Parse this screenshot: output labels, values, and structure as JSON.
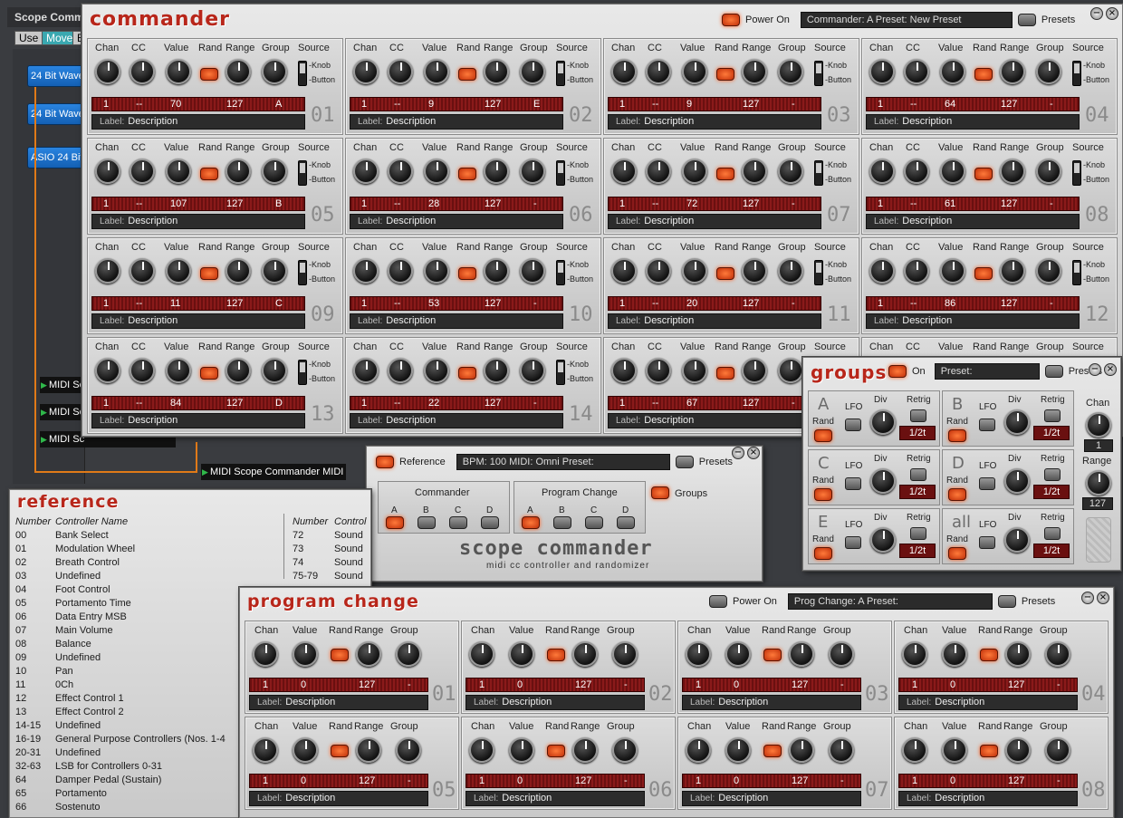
{
  "background": {
    "title": "Scope Comm",
    "tabs": [
      "Use",
      "Move",
      "E"
    ],
    "blocks": [
      "24 Bit Wave",
      "24 Bit Wave",
      "ASIO 24 Bit"
    ],
    "midi_blocks": [
      "MIDI Sc",
      "MIDI Sc",
      "MIDI Sc"
    ],
    "midi_main": "MIDI Scope Commander MIDI"
  },
  "commander": {
    "title": "commander",
    "power_label": "Power On",
    "display": "Commander: A   Preset:  New Preset",
    "presets_label": "Presets",
    "headers": {
      "chan": "Chan",
      "cc": "CC",
      "value": "Value",
      "rand": "Rand",
      "range": "Range",
      "group": "Group",
      "source": "Source",
      "knob": "-Knob",
      "button": "-Button",
      "label": "Label:"
    },
    "cells": [
      {
        "num": "01",
        "chan": "1",
        "cc": "--",
        "value": "70",
        "range": "127",
        "group": "A",
        "label": "Description"
      },
      {
        "num": "02",
        "chan": "1",
        "cc": "--",
        "value": "9",
        "range": "127",
        "group": "E",
        "label": "Description"
      },
      {
        "num": "03",
        "chan": "1",
        "cc": "--",
        "value": "9",
        "range": "127",
        "group": "-",
        "label": "Description"
      },
      {
        "num": "04",
        "chan": "1",
        "cc": "--",
        "value": "64",
        "range": "127",
        "group": "-",
        "label": "Description"
      },
      {
        "num": "05",
        "chan": "1",
        "cc": "--",
        "value": "107",
        "range": "127",
        "group": "B",
        "label": "Description"
      },
      {
        "num": "06",
        "chan": "1",
        "cc": "--",
        "value": "28",
        "range": "127",
        "group": "-",
        "label": "Description"
      },
      {
        "num": "07",
        "chan": "1",
        "cc": "--",
        "value": "72",
        "range": "127",
        "group": "-",
        "label": "Description"
      },
      {
        "num": "08",
        "chan": "1",
        "cc": "--",
        "value": "61",
        "range": "127",
        "group": "-",
        "label": "Description"
      },
      {
        "num": "09",
        "chan": "1",
        "cc": "--",
        "value": "11",
        "range": "127",
        "group": "C",
        "label": "Description"
      },
      {
        "num": "10",
        "chan": "1",
        "cc": "--",
        "value": "53",
        "range": "127",
        "group": "-",
        "label": "Description"
      },
      {
        "num": "11",
        "chan": "1",
        "cc": "--",
        "value": "20",
        "range": "127",
        "group": "-",
        "label": "Description"
      },
      {
        "num": "12",
        "chan": "1",
        "cc": "--",
        "value": "86",
        "range": "127",
        "group": "-",
        "label": "Description"
      },
      {
        "num": "13",
        "chan": "1",
        "cc": "--",
        "value": "84",
        "range": "127",
        "group": "D",
        "label": "Description"
      },
      {
        "num": "14",
        "chan": "1",
        "cc": "--",
        "value": "22",
        "range": "127",
        "group": "-",
        "label": "Description"
      },
      {
        "num": "",
        "chan": "1",
        "cc": "--",
        "value": "67",
        "range": "127",
        "group": "-",
        "label": "Description"
      },
      {
        "num": "",
        "chan": "",
        "cc": "",
        "value": "",
        "range": "",
        "group": "",
        "label": ""
      }
    ]
  },
  "groups": {
    "title": "groups",
    "on_label": "On",
    "preset_label": "Preset:",
    "presets_label": "Presets",
    "lfo": "LFO",
    "div": "Div",
    "retrig": "Retrig",
    "rand": "Rand",
    "chan_label": "Chan",
    "chan_value": "1",
    "range_label": "Range",
    "range_value": "127",
    "items": [
      {
        "letter": "A",
        "div": "1/2t"
      },
      {
        "letter": "B",
        "div": "1/2t"
      },
      {
        "letter": "C",
        "div": "1/2t"
      },
      {
        "letter": "D",
        "div": "1/2t"
      },
      {
        "letter": "E",
        "div": "1/2t"
      },
      {
        "letter": "all",
        "div": "1/2t"
      }
    ]
  },
  "main": {
    "reference_label": "Reference",
    "display": "BPM: 100   MIDI: Omni   Preset:",
    "presets_label": "Presets",
    "commander_label": "Commander",
    "program_change_label": "Program Change",
    "groups_label": "Groups",
    "letters": [
      "A",
      "B",
      "C",
      "D"
    ],
    "brand": "scope commander",
    "tagline": "midi cc controller and randomizer"
  },
  "reference": {
    "title": "reference",
    "col_number": "Number",
    "col_name": "Controller Name",
    "col2_name": "Control",
    "rows": [
      [
        "00",
        "Bank Select"
      ],
      [
        "01",
        "Modulation Wheel"
      ],
      [
        "02",
        "Breath Control"
      ],
      [
        "03",
        "Undefined"
      ],
      [
        "04",
        "Foot Control"
      ],
      [
        "05",
        "Portamento Time"
      ],
      [
        "06",
        "Data Entry MSB"
      ],
      [
        "07",
        "Main Volume"
      ],
      [
        "08",
        "Balance"
      ],
      [
        "09",
        "Undefined"
      ],
      [
        "10",
        "Pan"
      ],
      [
        "11",
        "0Ch"
      ],
      [
        "12",
        "Effect Control 1"
      ],
      [
        "13",
        "Effect Control 2"
      ],
      [
        "14-15",
        "Undefined"
      ],
      [
        "16-19",
        "General Purpose Controllers (Nos. 1-4"
      ],
      [
        "20-31",
        "Undefined"
      ],
      [
        "32-63",
        "LSB for Controllers 0-31"
      ],
      [
        "64",
        "Damper Pedal (Sustain)"
      ],
      [
        "65",
        "Portamento"
      ],
      [
        "66",
        "Sostenuto"
      ]
    ],
    "rows2": [
      [
        "72",
        "Sound"
      ],
      [
        "73",
        "Sound"
      ],
      [
        "74",
        "Sound"
      ],
      [
        "75-79",
        "Sound"
      ]
    ]
  },
  "program_change": {
    "title": "program change",
    "power_label": "Power On",
    "display": "Prog Change: A   Preset:",
    "presets_label": "Presets",
    "headers": {
      "chan": "Chan",
      "value": "Value",
      "rand": "Rand",
      "range": "Range",
      "group": "Group",
      "label": "Label:"
    },
    "cells": [
      {
        "num": "01",
        "chan": "1",
        "value": "0",
        "range": "127",
        "group": "-",
        "label": "Description"
      },
      {
        "num": "02",
        "chan": "1",
        "value": "0",
        "range": "127",
        "group": "-",
        "label": "Description"
      },
      {
        "num": "03",
        "chan": "1",
        "value": "0",
        "range": "127",
        "group": "-",
        "label": "Description"
      },
      {
        "num": "04",
        "chan": "1",
        "value": "0",
        "range": "127",
        "group": "-",
        "label": "Description"
      },
      {
        "num": "05",
        "chan": "1",
        "value": "0",
        "range": "127",
        "group": "-",
        "label": "Description"
      },
      {
        "num": "06",
        "chan": "1",
        "value": "0",
        "range": "127",
        "group": "-",
        "label": "Description"
      },
      {
        "num": "07",
        "chan": "1",
        "value": "0",
        "range": "127",
        "group": "-",
        "label": "Description"
      },
      {
        "num": "08",
        "chan": "1",
        "value": "0",
        "range": "127",
        "group": "-",
        "label": "Description"
      }
    ]
  }
}
